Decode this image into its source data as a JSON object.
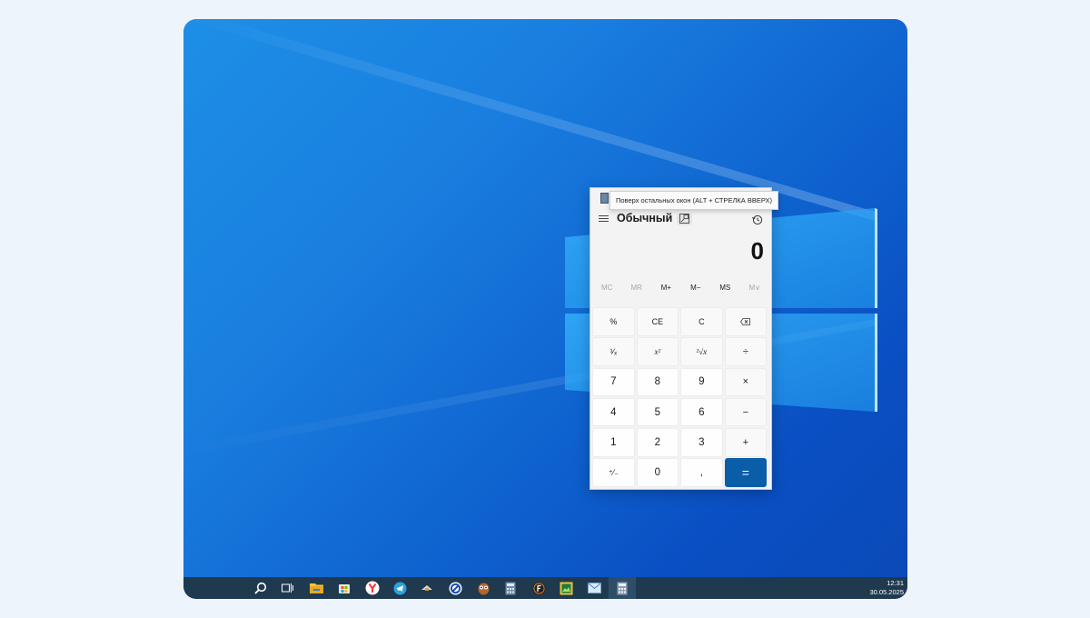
{
  "calculator": {
    "tooltip": "Поверх остальных окон (ALT + СТРЕЛКА ВВЕРХ)",
    "mode_title": "Обычный",
    "display": "0",
    "memory": [
      {
        "label": "MC",
        "enabled": false
      },
      {
        "label": "MR",
        "enabled": false
      },
      {
        "label": "M+",
        "enabled": true
      },
      {
        "label": "M−",
        "enabled": true
      },
      {
        "label": "MS",
        "enabled": true
      },
      {
        "label": "M∨",
        "enabled": false
      }
    ],
    "keys": {
      "percent": "%",
      "ce": "CE",
      "c": "C",
      "reciprocal": "¹⁄ₓ",
      "square": "x²",
      "sqrt": "²√x",
      "divide": "÷",
      "n7": "7",
      "n8": "8",
      "n9": "9",
      "multiply": "×",
      "n4": "4",
      "n5": "5",
      "n6": "6",
      "minus": "−",
      "n1": "1",
      "n2": "2",
      "n3": "3",
      "plus": "+",
      "negate": "⁺⁄₋",
      "n0": "0",
      "decimal": ",",
      "equals": "="
    }
  },
  "taskbar": {
    "time": "12:31",
    "date": "30.05.2025",
    "icons": [
      "search-icon",
      "task-view-icon",
      "file-explorer-icon",
      "microsoft-store-icon",
      "yandex-browser-icon",
      "telegram-icon",
      "app-icon",
      "browser-icon",
      "owl-icon",
      "calculator-icon",
      "f-app-icon",
      "gallery-icon",
      "mail-icon",
      "calculator-active-icon"
    ]
  },
  "colors": {
    "accent": "#0a5ea8",
    "taskbar": "#1f3a4f",
    "wallpaper": "#1a7fe0"
  }
}
